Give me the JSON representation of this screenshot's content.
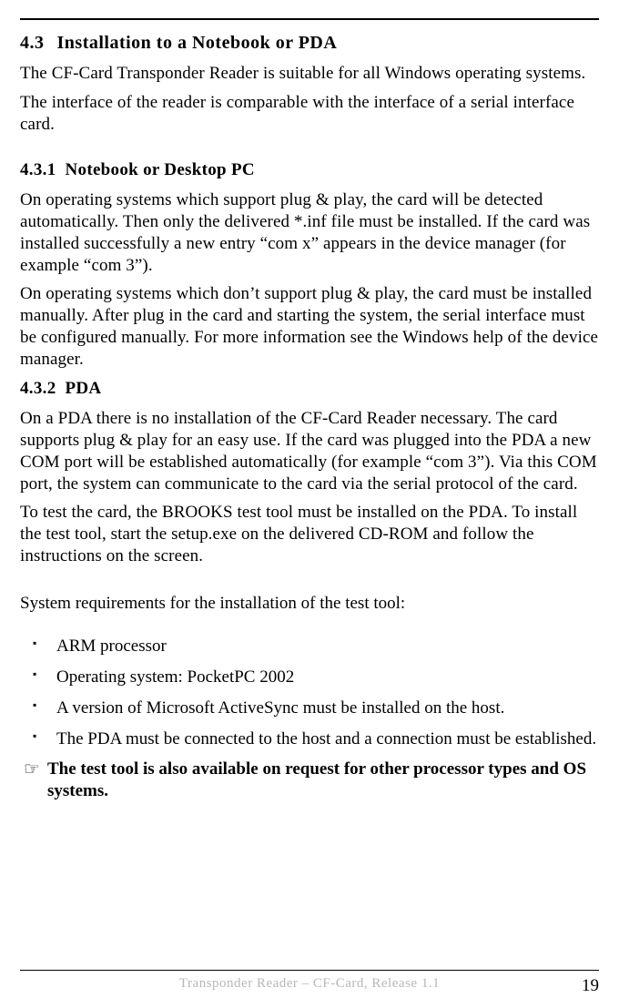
{
  "section": {
    "number": "4.3",
    "title": "Installation to a Notebook or PDA",
    "p1": "The CF-Card Transponder Reader is suitable for all Windows operating systems.",
    "p2": "The interface of the reader is comparable with the interface of a serial interface card."
  },
  "sub1": {
    "number": "4.3.1",
    "title": "Notebook or Desktop PC",
    "p1": "On operating systems which support plug & play, the card will be detected automatically. Then only the delivered *.inf file must be installed. If the card was installed successfully a new entry “com x” appears in the device manager (for example “com 3”).",
    "p2": "On operating systems which don’t support plug & play, the card must be installed manually. After plug in the card and starting the system, the serial interface must be configured manually. For more information see the Windows help of the device manager."
  },
  "sub2": {
    "number": "4.3.2",
    "title": "PDA",
    "p1": "On a PDA there is no installation of the CF-Card Reader necessary. The card supports plug & play for an easy use. If the card was plugged into the PDA a new COM port will be established automatically (for example “com 3”). Via this COM port, the system can communicate to the card via the serial protocol of the card.",
    "p2": "To test the card, the BROOKS test tool must be installed on the PDA. To install the test tool, start the setup.exe on the delivered CD-ROM and follow the instructions on the screen.",
    "reqlabel": "System requirements for the installation of the test tool:",
    "req": [
      "ARM processor",
      "Operating system: PocketPC 2002",
      "A version of Microsoft ActiveSync must be installed on the host.",
      "The PDA must be connected to the host and a connection must be established."
    ],
    "note": "The test tool is also available on request for other processor types and OS systems."
  },
  "footer": {
    "center": "Transponder Reader – CF-Card, Release 1.1",
    "page": "19"
  }
}
